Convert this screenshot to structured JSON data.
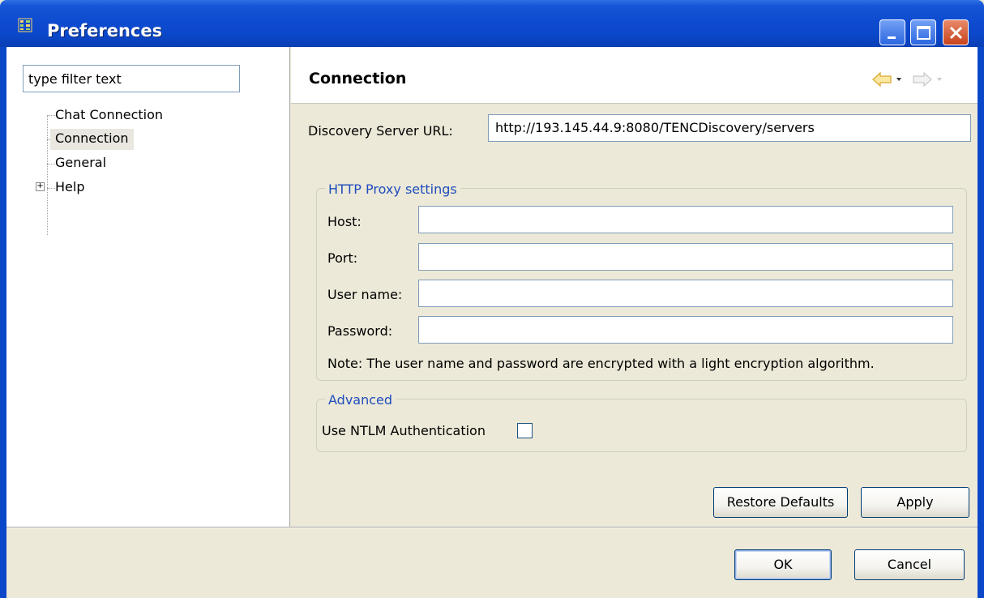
{
  "window": {
    "title": "Preferences",
    "icons": [
      "preferences-app-icon",
      "minimize-icon",
      "maximize-icon",
      "close-icon"
    ]
  },
  "sidebar": {
    "filter_placeholder": "type filter text",
    "filter_value": "type filter text",
    "items": [
      {
        "label": "Chat Connection",
        "selected": false,
        "expandable": false
      },
      {
        "label": "Connection",
        "selected": true,
        "expandable": false
      },
      {
        "label": "General",
        "selected": false,
        "expandable": false
      },
      {
        "label": "Help",
        "selected": false,
        "expandable": true,
        "expander_symbol": "+"
      }
    ]
  },
  "page": {
    "title": "Connection",
    "nav_icons": [
      "back-arrow-icon",
      "back-menu-chevron-icon",
      "forward-arrow-icon",
      "forward-menu-chevron-icon"
    ],
    "discovery_label": "Discovery Server URL:",
    "discovery_value": "http://193.145.44.9:8080/TENCDiscovery/servers",
    "proxy": {
      "legend": "HTTP Proxy settings",
      "host_label": "Host:",
      "host_value": "",
      "port_label": "Port:",
      "port_value": "",
      "username_label": "User name:",
      "username_value": "",
      "password_label": "Password:",
      "password_value": "",
      "note": "Note: The user name and password are encrypted with a light encryption algorithm."
    },
    "advanced": {
      "legend": "Advanced",
      "ntlm_label": "Use NTLM Authentication",
      "ntlm_checked": false
    },
    "restore_defaults_label": "Restore Defaults",
    "apply_label": "Apply"
  },
  "dialog": {
    "ok_label": "OK",
    "cancel_label": "Cancel"
  },
  "colors": {
    "titlebar": "#0b47c9",
    "legend_text": "#1f4dbd",
    "dialog_bg": "#ece9d8",
    "selection_bg": "#e9e7df"
  }
}
